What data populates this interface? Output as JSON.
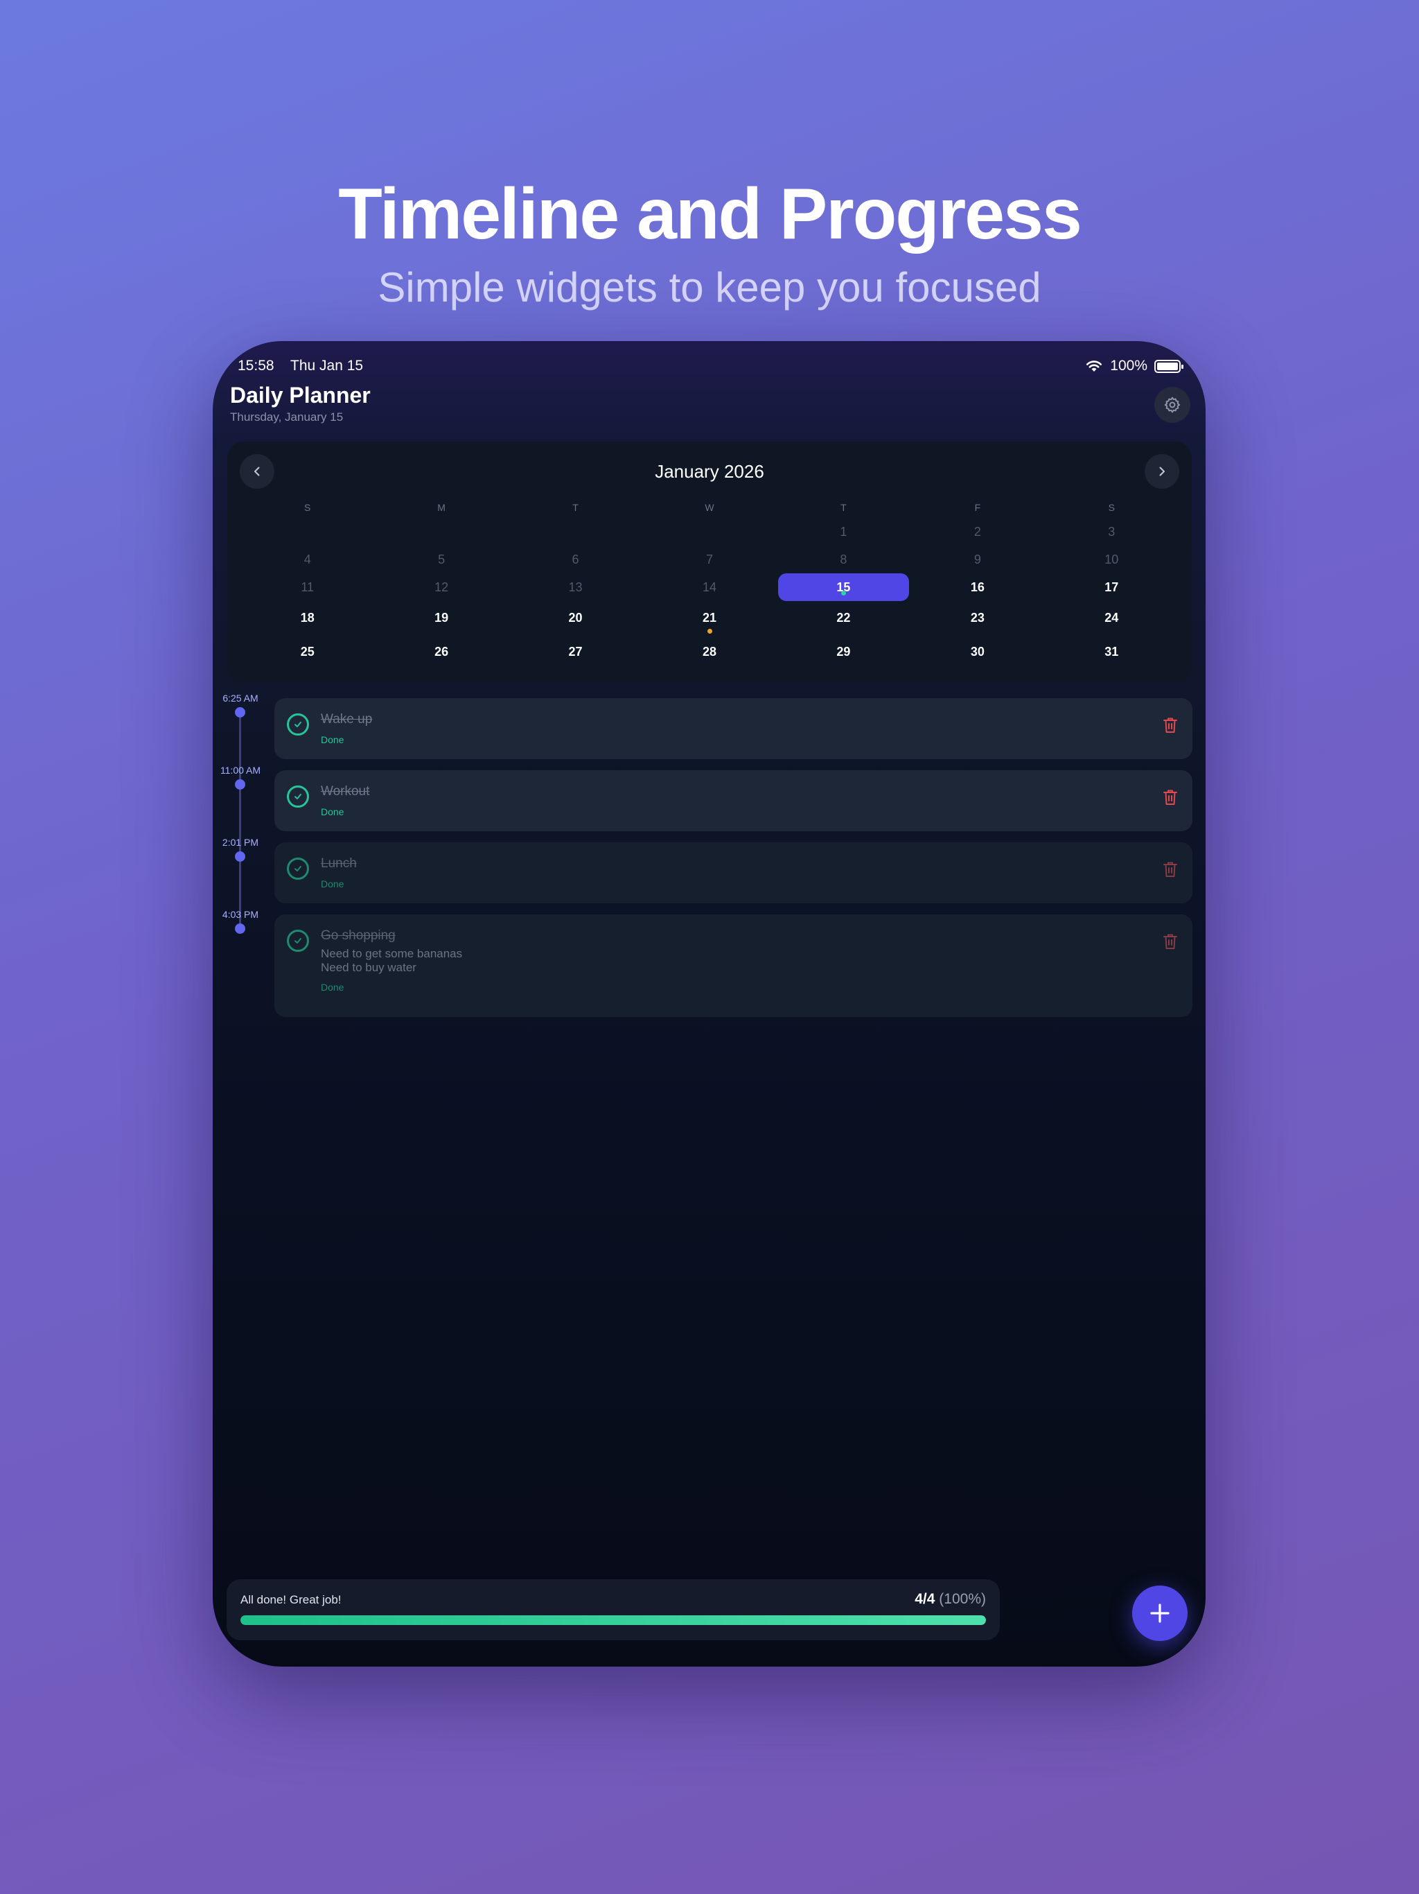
{
  "hero": {
    "title": "Timeline and Progress",
    "subtitle": "Simple widgets to keep you focused"
  },
  "status_bar": {
    "time": "15:58",
    "date": "Thu Jan 15",
    "battery": "100%",
    "icons": [
      "wifi-icon",
      "battery-icon"
    ]
  },
  "header": {
    "title": "Daily Planner",
    "subtitle": "Thursday, January 15",
    "settings_icon": "gear-icon"
  },
  "calendar": {
    "month_label": "January 2026",
    "weekdays": [
      "S",
      "M",
      "T",
      "W",
      "T",
      "F",
      "S"
    ],
    "weeks": [
      [
        "",
        "",
        "",
        "",
        "1",
        "2",
        "3"
      ],
      [
        "4",
        "5",
        "6",
        "7",
        "8",
        "9",
        "10"
      ],
      [
        "11",
        "12",
        "13",
        "14",
        "15",
        "16",
        "17"
      ],
      [
        "18",
        "19",
        "20",
        "21",
        "22",
        "23",
        "24"
      ],
      [
        "25",
        "26",
        "27",
        "28",
        "29",
        "30",
        "31"
      ]
    ],
    "today": "15",
    "marked_days": [
      "21"
    ],
    "colors": {
      "today_bg": "#4f46e5",
      "today_dot": "#2dd4a7",
      "marked_dot": "#f0a326"
    }
  },
  "tasks": [
    {
      "time": "6:25 AM",
      "title": "Wake up",
      "notes": [],
      "status": "Done"
    },
    {
      "time": "11:00 AM",
      "title": "Workout",
      "notes": [],
      "status": "Done"
    },
    {
      "time": "2:01 PM",
      "title": "Lunch",
      "notes": [],
      "status": "Done"
    },
    {
      "time": "4:03 PM",
      "title": "Go shopping",
      "notes": [
        "Need to get some bananas",
        "Need to buy water"
      ],
      "status": "Done"
    }
  ],
  "progress": {
    "message": "All done! Great job!",
    "count": "4/4",
    "percent_label": "(100%)",
    "fraction": 1.0,
    "color": "#26c49a"
  },
  "fab": {
    "icon": "plus-icon"
  },
  "colors": {
    "accent": "#4f46e5",
    "success": "#26c49a",
    "danger": "#e5484d"
  }
}
